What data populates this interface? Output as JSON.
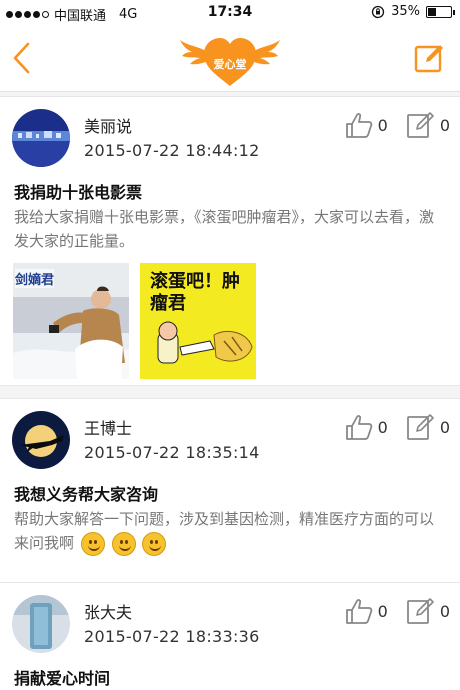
{
  "status": {
    "carrier": "中国联通",
    "network": "4G",
    "time": "17:34",
    "battery": "35%",
    "battery_level": 0.35
  },
  "header": {
    "logo_text": "爱心堂",
    "back_icon": "chevron-left-icon",
    "edit_icon": "edit-icon",
    "accent": "#f7931e"
  },
  "posts": [
    {
      "author": "美丽说",
      "time": "2015-07-22 18:44:12",
      "likes": "0",
      "comments": "0",
      "title": "我捐助十张电影票",
      "content": "我给大家捐赠十张电影票，《滚蛋吧肿瘤君》，大家可以去看，激发大家的正能量。",
      "thumb1_text": "剑嫡君",
      "thumb2_text": "滚蛋吧！肿瘤君"
    },
    {
      "author": "王博士",
      "time": "2015-07-22 18:35:14",
      "likes": "0",
      "comments": "0",
      "title": "我想义务帮大家咨询",
      "content": "帮助大家解答一下问题，涉及到基因检测，精准医疗方面的可以来问我啊"
    },
    {
      "author": "张大夫",
      "time": "2015-07-22 18:33:36",
      "likes": "0",
      "comments": "0",
      "title": "捐献爱心时间"
    }
  ]
}
